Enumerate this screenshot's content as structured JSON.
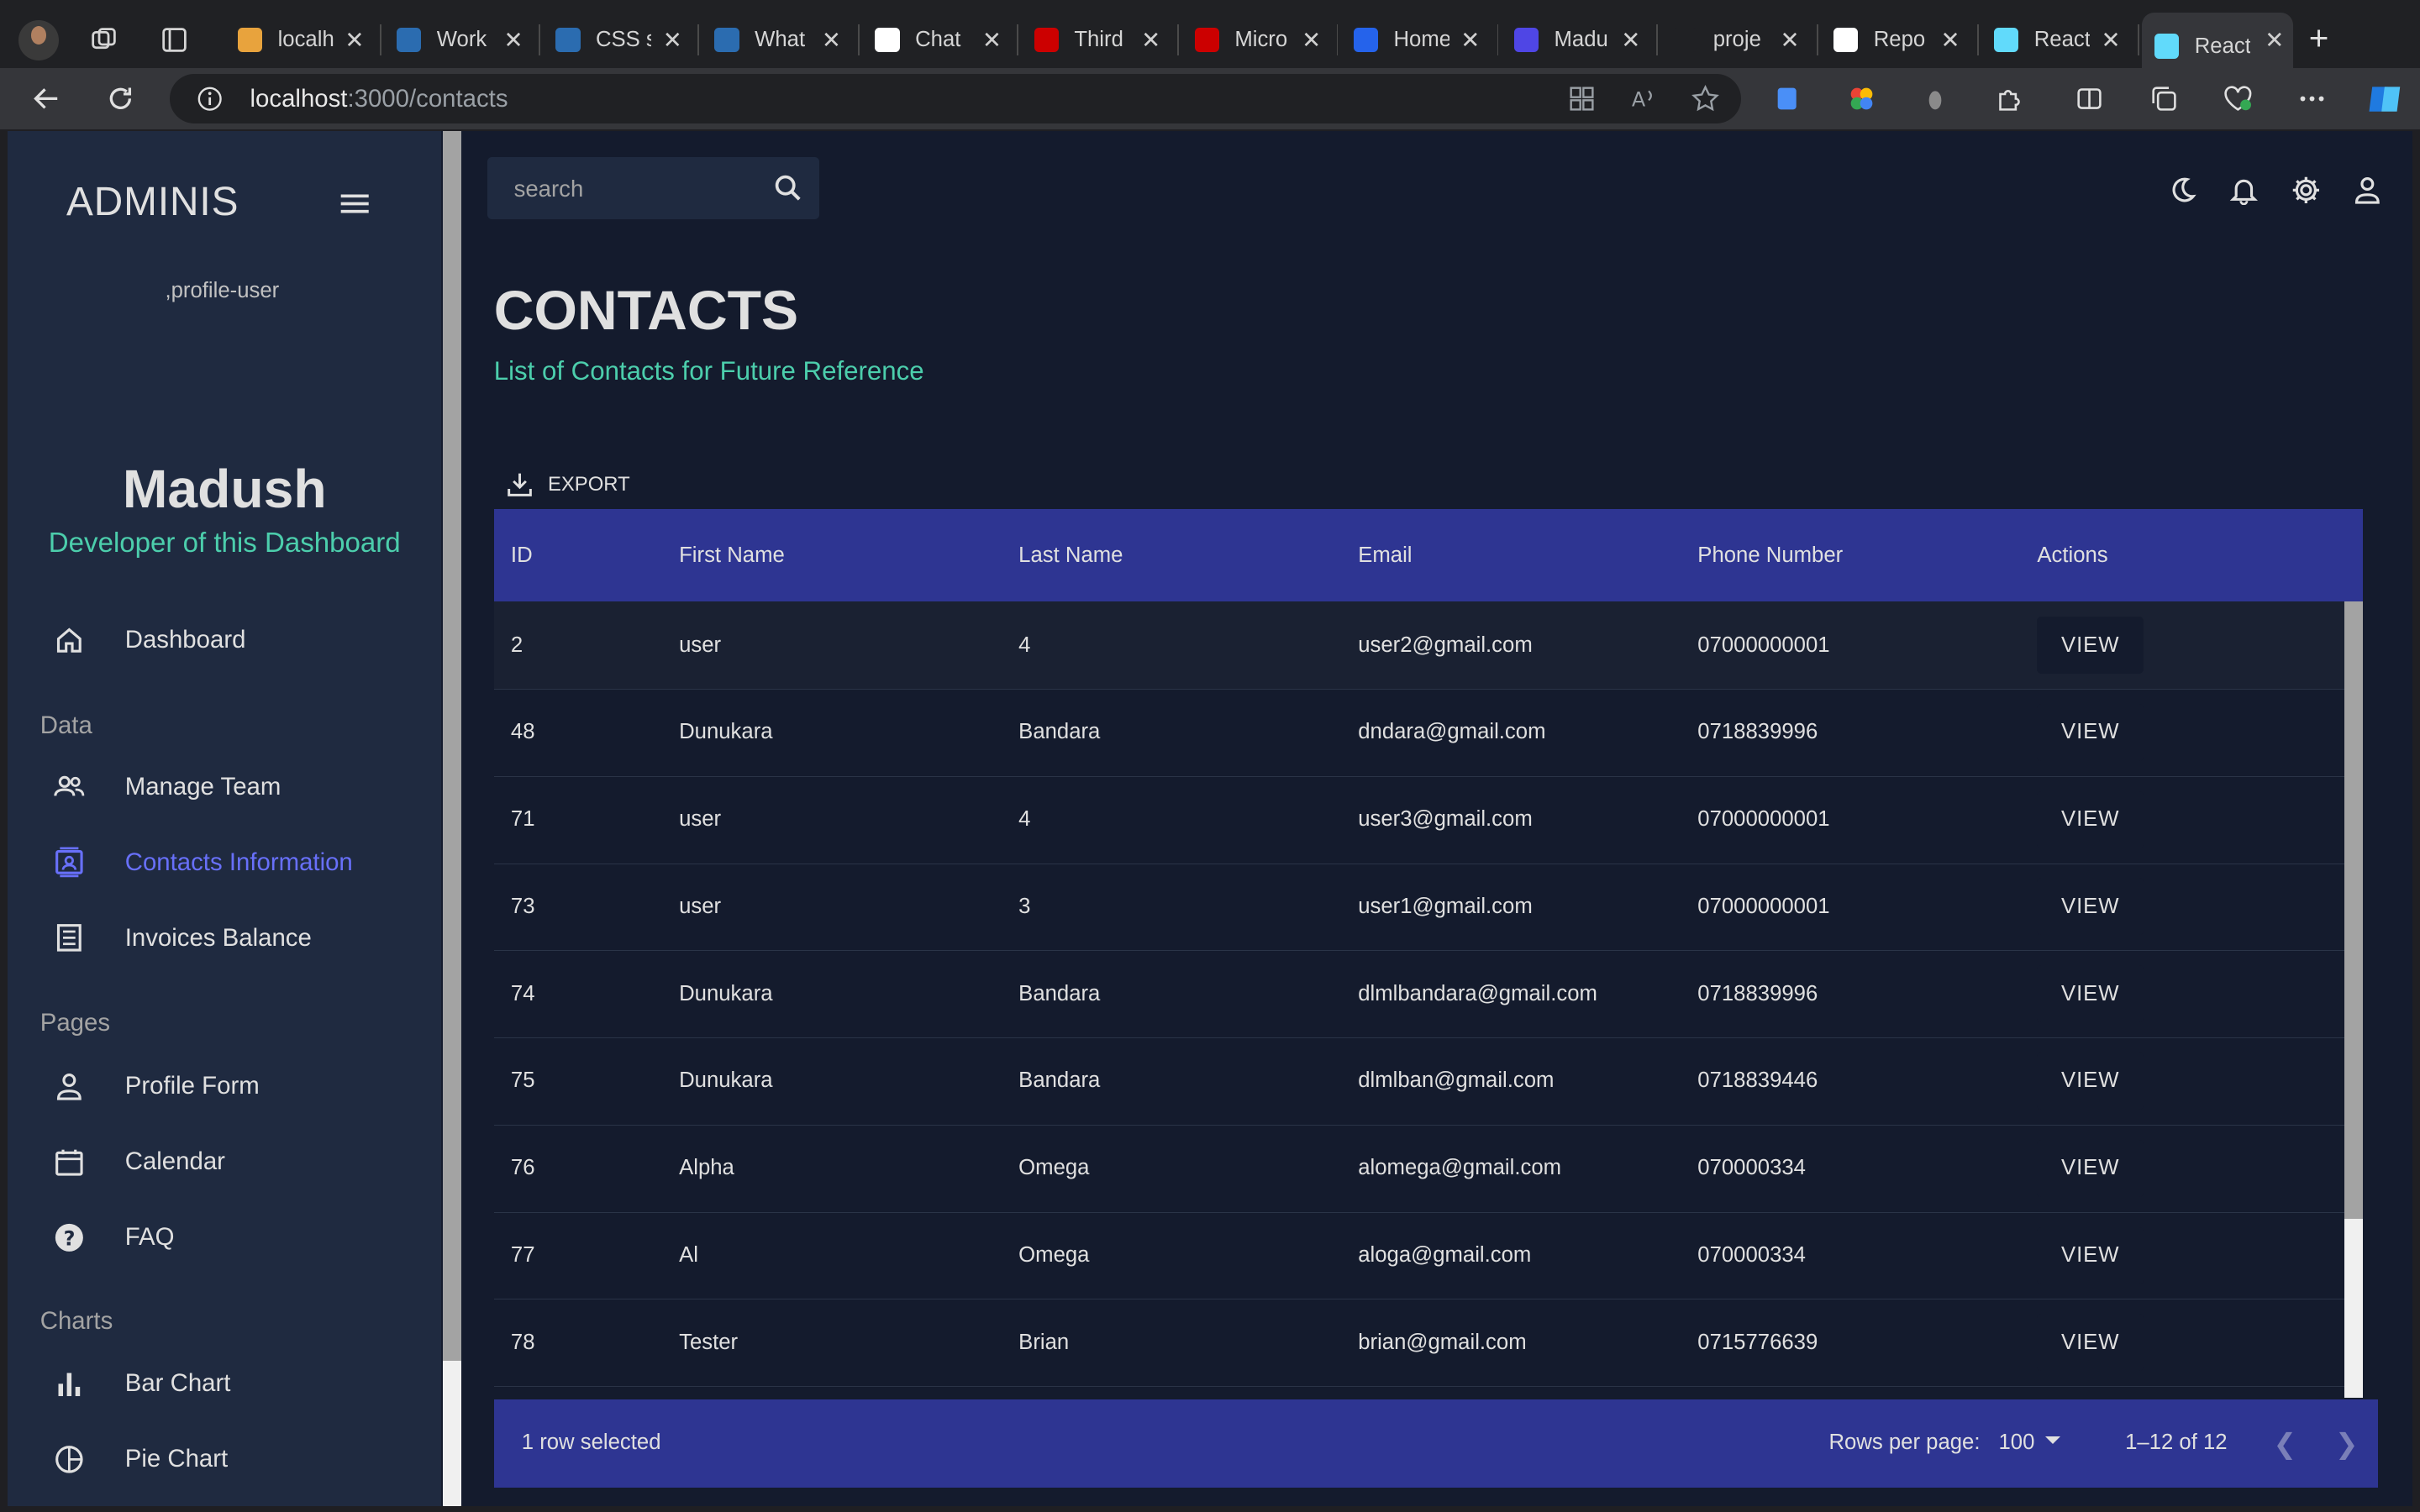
{
  "browser": {
    "tabs": [
      {
        "title": "localh",
        "color": "#e8a33d"
      },
      {
        "title": "Work",
        "color": "#2b6cb0"
      },
      {
        "title": "CSS s",
        "color": "#2b6cb0"
      },
      {
        "title": "What",
        "color": "#2b6cb0"
      },
      {
        "title": "Chat",
        "color": "#ffffff"
      },
      {
        "title": "Third",
        "color": "#cc0000"
      },
      {
        "title": "Micro",
        "color": "#cc0000"
      },
      {
        "title": "Home",
        "color": "#2563eb"
      },
      {
        "title": "Madu",
        "color": "#4f46e5"
      },
      {
        "title": "proje",
        "color": "#202124"
      },
      {
        "title": "Repo",
        "color": "#ffffff"
      },
      {
        "title": "React",
        "color": "#61dafb"
      },
      {
        "title": "React",
        "color": "#61dafb"
      }
    ],
    "url_host": "localhost",
    "url_path": ":3000/contacts"
  },
  "sidebar": {
    "brand": "ADMINIS",
    "profile_alt": ",profile-user",
    "user_name": "Madush",
    "user_role": "Developer of this Dashboard",
    "items": [
      {
        "label": "Dashboard",
        "icon": "home-icon"
      },
      {
        "label": "Manage Team",
        "icon": "people-icon"
      },
      {
        "label": "Contacts Information",
        "icon": "contacts-icon"
      },
      {
        "label": "Invoices Balance",
        "icon": "receipt-icon"
      },
      {
        "label": "Profile Form",
        "icon": "person-icon"
      },
      {
        "label": "Calendar",
        "icon": "calendar-icon"
      },
      {
        "label": "FAQ",
        "icon": "help-icon"
      },
      {
        "label": "Bar Chart",
        "icon": "bar-chart-icon"
      },
      {
        "label": "Pie Chart",
        "icon": "pie-chart-icon"
      }
    ],
    "sections": {
      "data": "Data",
      "pages": "Pages",
      "charts": "Charts"
    }
  },
  "header": {
    "search_placeholder": "search"
  },
  "page": {
    "title": "CONTACTS",
    "subtitle": "List of Contacts for Future Reference",
    "export_label": "EXPORT"
  },
  "table": {
    "columns": [
      "ID",
      "First Name",
      "Last Name",
      "Email",
      "Phone Number",
      "Actions"
    ],
    "rows": [
      {
        "id": "2",
        "first": "user",
        "last": "4",
        "email": "user2@gmail.com",
        "phone": "07000000001",
        "action": "VIEW"
      },
      {
        "id": "48",
        "first": "Dunukara",
        "last": "Bandara",
        "email": "dndara@gmail.com",
        "phone": "0718839996",
        "action": "VIEW"
      },
      {
        "id": "71",
        "first": "user",
        "last": "4",
        "email": "user3@gmail.com",
        "phone": "07000000001",
        "action": "VIEW"
      },
      {
        "id": "73",
        "first": "user",
        "last": "3",
        "email": "user1@gmail.com",
        "phone": "07000000001",
        "action": "VIEW"
      },
      {
        "id": "74",
        "first": "Dunukara",
        "last": "Bandara",
        "email": "dlmlbandara@gmail.com",
        "phone": "0718839996",
        "action": "VIEW"
      },
      {
        "id": "75",
        "first": "Dunukara",
        "last": "Bandara",
        "email": "dlmlban@gmail.com",
        "phone": "0718839446",
        "action": "VIEW"
      },
      {
        "id": "76",
        "first": "Alpha",
        "last": "Omega",
        "email": "alomega@gmail.com",
        "phone": "070000334",
        "action": "VIEW"
      },
      {
        "id": "77",
        "first": "Al",
        "last": "Omega",
        "email": "aloga@gmail.com",
        "phone": "070000334",
        "action": "VIEW"
      },
      {
        "id": "78",
        "first": "Tester",
        "last": "Brian",
        "email": "brian@gmail.com",
        "phone": "0715776639",
        "action": "VIEW"
      }
    ],
    "footer": {
      "selected": "1 row selected",
      "rows_per_page_label": "Rows per page:",
      "rows_per_page": "100",
      "range": "1–12 of 12"
    }
  },
  "colors": {
    "background": "#141b2d",
    "panel": "#1f2a40",
    "accent_green": "#4cceac",
    "accent_blue": "#6870fa",
    "table_header": "#2e3592"
  }
}
